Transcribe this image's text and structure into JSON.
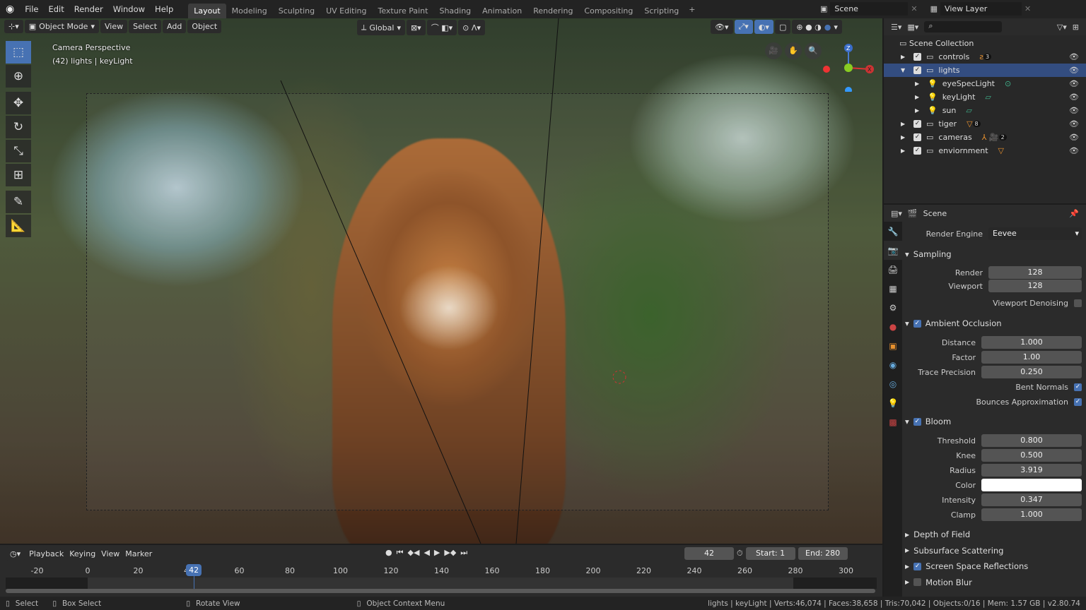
{
  "menu": [
    "File",
    "Edit",
    "Render",
    "Window",
    "Help"
  ],
  "workspaces": [
    "Layout",
    "Modeling",
    "Sculpting",
    "UV Editing",
    "Texture Paint",
    "Shading",
    "Animation",
    "Rendering",
    "Compositing",
    "Scripting"
  ],
  "active_workspace": "Layout",
  "scene": "Scene",
  "view_layer": "View Layer",
  "viewport": {
    "mode": "Object Mode",
    "menus": [
      "View",
      "Select",
      "Add",
      "Object"
    ],
    "transform": "Global",
    "overlay_title": "Camera Perspective",
    "overlay_sub": "(42) lights | keyLight"
  },
  "outliner": {
    "root": "Scene Collection",
    "items": [
      {
        "name": "controls",
        "level": 0,
        "badge": "3"
      },
      {
        "name": "lights",
        "level": 0,
        "selected": true
      },
      {
        "name": "eyeSpecLight",
        "level": 1
      },
      {
        "name": "keyLight",
        "level": 1
      },
      {
        "name": "sun",
        "level": 1
      },
      {
        "name": "tiger",
        "level": 0,
        "badge": "8"
      },
      {
        "name": "cameras",
        "level": 0,
        "badge": "2"
      },
      {
        "name": "enviornment",
        "level": 0
      }
    ]
  },
  "properties": {
    "context": "Scene",
    "render_engine_label": "Render Engine",
    "render_engine": "Eevee",
    "sampling": {
      "title": "Sampling",
      "render_label": "Render",
      "render": "128",
      "viewport_label": "Viewport",
      "viewport": "128",
      "denoise_label": "Viewport Denoising"
    },
    "ao": {
      "title": "Ambient Occlusion",
      "distance_label": "Distance",
      "distance": "1.000",
      "factor_label": "Factor",
      "factor": "1.00",
      "trace_label": "Trace Precision",
      "trace": "0.250",
      "bent_label": "Bent Normals",
      "bounce_label": "Bounces Approximation"
    },
    "bloom": {
      "title": "Bloom",
      "threshold_label": "Threshold",
      "threshold": "0.800",
      "knee_label": "Knee",
      "knee": "0.500",
      "radius_label": "Radius",
      "radius": "3.919",
      "color_label": "Color",
      "intensity_label": "Intensity",
      "intensity": "0.347",
      "clamp_label": "Clamp",
      "clamp": "1.000"
    },
    "collapsed": [
      "Depth of Field",
      "Subsurface Scattering",
      "Screen Space Reflections",
      "Motion Blur"
    ]
  },
  "timeline": {
    "menus": [
      "Playback",
      "Keying",
      "View",
      "Marker"
    ],
    "current": "42",
    "start_label": "Start:",
    "start": "1",
    "end_label": "End:",
    "end": "280",
    "ticks": [
      "-20",
      "0",
      "20",
      "40",
      "60",
      "80",
      "100",
      "120",
      "140",
      "160",
      "180",
      "200",
      "220",
      "240",
      "260",
      "280",
      "300"
    ]
  },
  "status": {
    "select": "Select",
    "box_select": "Box Select",
    "rotate": "Rotate View",
    "context": "Object Context Menu",
    "info": "lights | keyLight | Verts:46,074 | Faces:38,658 | Tris:70,042 | Objects:0/16 | Mem: 1.57 GB | v2.80.74"
  },
  "colors": {
    "accent": "#4772b3",
    "selected_row": "#334d80",
    "object_orange": "#e8912e",
    "data_green": "#3fb08a"
  }
}
